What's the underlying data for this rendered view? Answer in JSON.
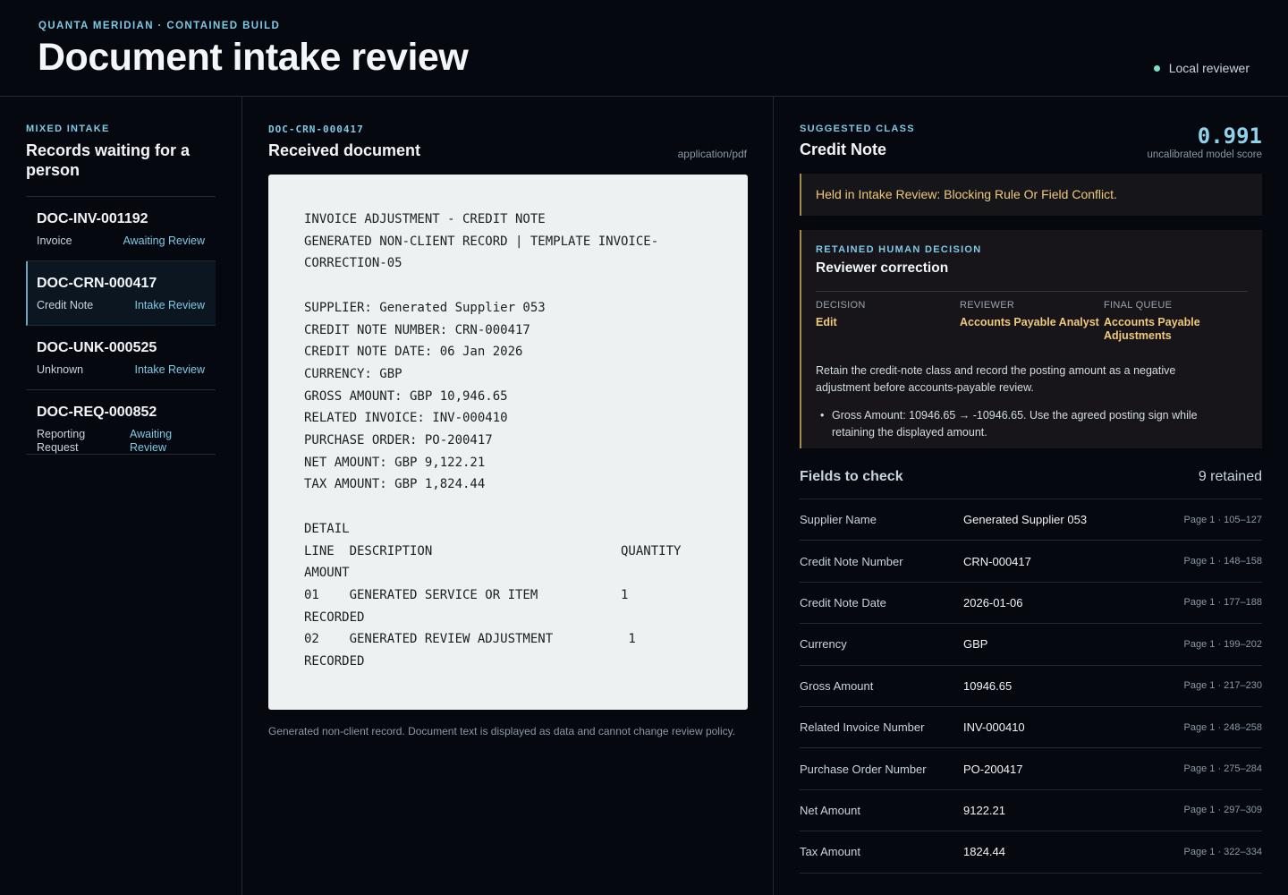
{
  "header": {
    "eyebrow": "QUANTA MERIDIAN · CONTAINED BUILD",
    "title": "Document intake review",
    "reviewer": "Local reviewer"
  },
  "left": {
    "label": "MIXED INTAKE",
    "title": "Records waiting for a person",
    "records": [
      {
        "id": "DOC-INV-001192",
        "type": "Invoice",
        "status": "Awaiting Review"
      },
      {
        "id": "DOC-CRN-000417",
        "type": "Credit Note",
        "status": "Intake Review"
      },
      {
        "id": "DOC-UNK-000525",
        "type": "Unknown",
        "status": "Intake Review"
      },
      {
        "id": "DOC-REQ-000852",
        "type": "Reporting Request",
        "status": "Awaiting Review"
      }
    ]
  },
  "middle": {
    "doc_id": "DOC-CRN-000417",
    "title": "Received document",
    "mime": "application/pdf",
    "document_text": "INVOICE ADJUSTMENT - CREDIT NOTE\nGENERATED NON-CLIENT RECORD | TEMPLATE INVOICE-\nCORRECTION-05\n\nSUPPLIER: Generated Supplier 053\nCREDIT NOTE NUMBER: CRN-000417\nCREDIT NOTE DATE: 06 Jan 2026\nCURRENCY: GBP\nGROSS AMOUNT: GBP 10,946.65\nRELATED INVOICE: INV-000410\nPURCHASE ORDER: PO-200417\nNET AMOUNT: GBP 9,122.21\nTAX AMOUNT: GBP 1,824.44\n\nDETAIL\nLINE  DESCRIPTION                         QUANTITY\nAMOUNT\n01    GENERATED SERVICE OR ITEM           1\nRECORDED\n02    GENERATED REVIEW ADJUSTMENT          1\nRECORDED",
    "note": "Generated non-client record. Document text is displayed as data and cannot change review policy."
  },
  "right": {
    "label": "SUGGESTED CLASS",
    "class": "Credit Note",
    "score": "0.991",
    "score_caption": "uncalibrated model score",
    "held": "Held in Intake Review: Blocking Rule Or Field Conflict.",
    "decision": {
      "label": "RETAINED HUMAN DECISION",
      "title": "Reviewer correction",
      "cells": [
        {
          "k": "DECISION",
          "v": "Edit"
        },
        {
          "k": "REVIEWER",
          "v": "Accounts Payable Analyst"
        },
        {
          "k": "FINAL QUEUE",
          "v": "Accounts Payable Adjustments"
        }
      ],
      "text": "Retain the credit-note class and record the posting amount as a negative adjustment before accounts-payable review.",
      "bullet": "Gross Amount: 10946.65 → -10946.65. Use the agreed posting sign while retaining the displayed amount."
    },
    "fields_title": "Fields to check",
    "fields_count": "9 retained",
    "fields": [
      {
        "name": "Supplier Name",
        "value": "Generated Supplier 053",
        "pos": "Page 1 · 105–127"
      },
      {
        "name": "Credit Note Number",
        "value": "CRN-000417",
        "pos": "Page 1 · 148–158"
      },
      {
        "name": "Credit Note Date",
        "value": "2026-01-06",
        "pos": "Page 1 · 177–188"
      },
      {
        "name": "Currency",
        "value": "GBP",
        "pos": "Page 1 · 199–202"
      },
      {
        "name": "Gross Amount",
        "value": "10946.65",
        "pos": "Page 1 · 217–230"
      },
      {
        "name": "Related Invoice Number",
        "value": "INV-000410",
        "pos": "Page 1 · 248–258"
      },
      {
        "name": "Purchase Order Number",
        "value": "PO-200417",
        "pos": "Page 1 · 275–284"
      },
      {
        "name": "Net Amount",
        "value": "9122.21",
        "pos": "Page 1 · 297–309"
      },
      {
        "name": "Tax Amount",
        "value": "1824.44",
        "pos": "Page 1 · 322–334"
      }
    ]
  }
}
